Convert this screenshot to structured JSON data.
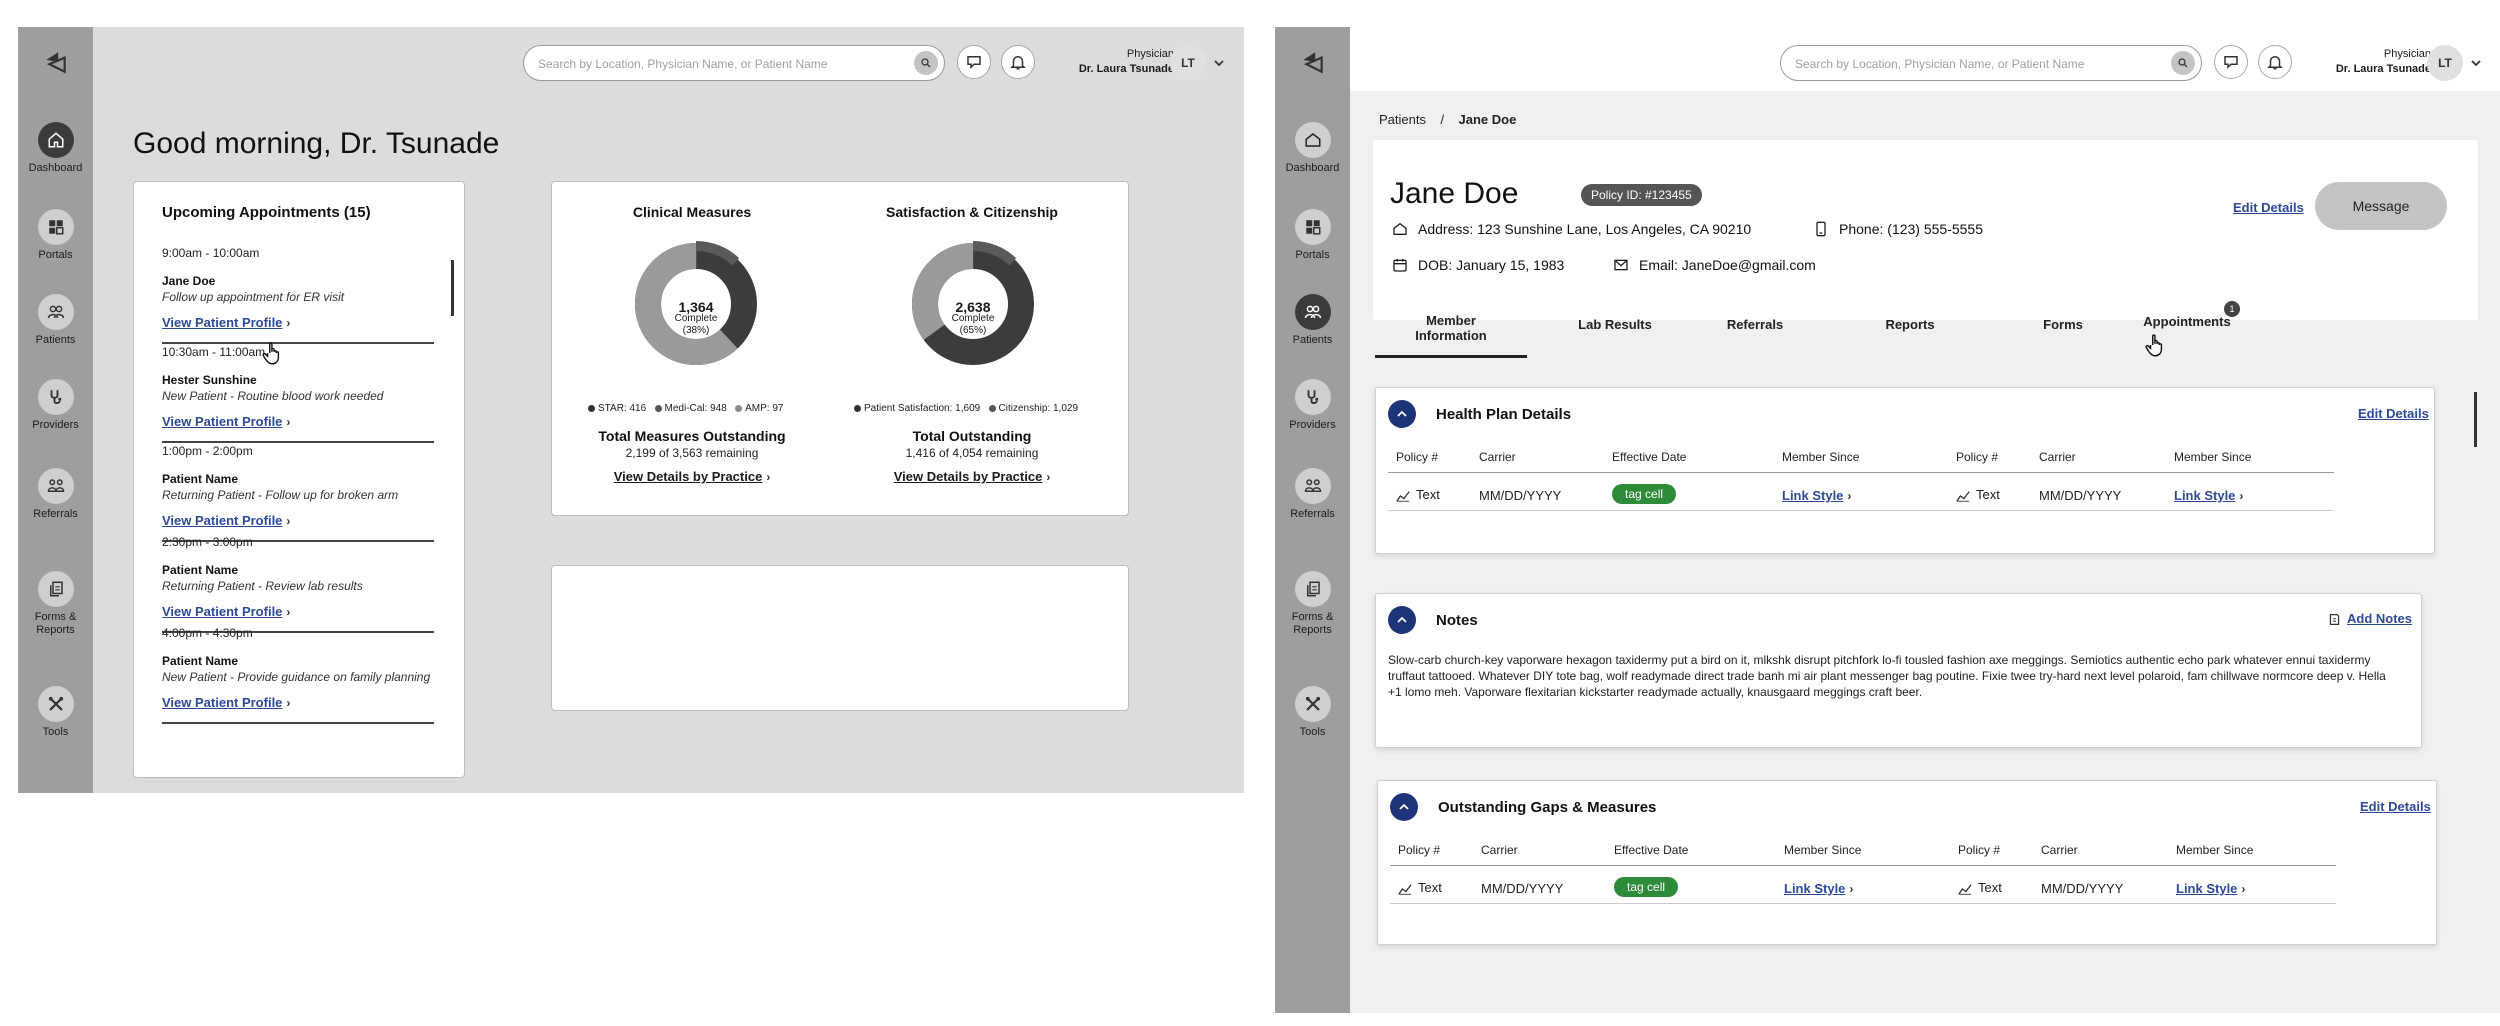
{
  "common": {
    "search_placeholder": "Search by Location, Physician Name, or Patient Name",
    "user_role": "Physician",
    "user_name": "Dr. Laura Tsunade",
    "avatar_initials": "LT"
  },
  "nav": [
    {
      "label": "Dashboard",
      "icon": "home-icon"
    },
    {
      "label": "Portals",
      "icon": "grid-icon"
    },
    {
      "label": "Patients",
      "icon": "users-icon"
    },
    {
      "label": "Providers",
      "icon": "stethoscope-icon"
    },
    {
      "label": "Referrals",
      "icon": "referrals-icon"
    },
    {
      "label": "Forms &",
      "label2": "Reports",
      "icon": "documents-icon"
    },
    {
      "label": "Tools",
      "icon": "tools-icon"
    }
  ],
  "dashboard": {
    "greeting": "Good morning, Dr. Tsunade",
    "appointments_title": "Upcoming Appointments (15)",
    "appointments": [
      {
        "time": "9:00am - 10:00am",
        "name": "Jane Doe",
        "desc": "Follow up appointment for ER visit",
        "link": "View Patient Profile"
      },
      {
        "time": "10:30am - 11:00am",
        "name": "Hester Sunshine",
        "desc": "New Patient - Routine blood work needed",
        "link": "View Patient Profile"
      },
      {
        "time": "1:00pm - 2:00pm",
        "name": "Patient Name",
        "desc": "Returning Patient - Follow up for broken arm",
        "link": "View Patient Profile"
      },
      {
        "time": "2:30pm - 3:00pm",
        "name": "Patient Name",
        "desc": "Returning Patient - Review lab results",
        "link": "View Patient Profile"
      },
      {
        "time": "4:00pm - 4:30pm",
        "name": "Patient Name",
        "desc": "New Patient - Provide guidance on family planning",
        "link": "View Patient Profile"
      }
    ],
    "clinical": {
      "title": "Clinical Measures",
      "center_value": "1,364",
      "center_label": "Complete",
      "center_pct": "(38%)",
      "percent": 38,
      "legend": [
        "STAR: 416",
        "Medi-Cal: 948",
        "AMP: 97"
      ],
      "total_title": "Total Measures Outstanding",
      "total_sub": "2,199 of 3,563 remaining",
      "link": "View Details by Practice"
    },
    "satisfaction": {
      "title": "Satisfaction & Citizenship",
      "center_value": "2,638",
      "center_label": "Complete",
      "center_pct": "(65%)",
      "percent": 65,
      "legend": [
        "Patient Satisfaction: 1,609",
        "Citizenship: 1,029"
      ],
      "total_title": "Total Outstanding",
      "total_sub": "1,416 of 4,054 remaining",
      "link": "View Details by Practice"
    }
  },
  "patient": {
    "breadcrumb_root": "Patients",
    "breadcrumb_sep": "/",
    "breadcrumb_current": "Jane Doe",
    "name": "Jane Doe",
    "policy_id": "Policy ID: #123455",
    "address": "Address: 123 Sunshine Lane, Los Angeles, CA 90210",
    "phone": "Phone: (123) 555-5555",
    "dob": "DOB: January 15, 1983",
    "email": "Email: JaneDoe@gmail.com",
    "edit_details": "Edit Details",
    "message": "Message",
    "tabs": [
      {
        "label": "Member",
        "label2": "Information"
      },
      {
        "label": "Lab Results"
      },
      {
        "label": "Referrals"
      },
      {
        "label": "Reports"
      },
      {
        "label": "Forms"
      },
      {
        "label": "Appointments",
        "badge": "1"
      }
    ],
    "health_plan": {
      "title": "Health Plan Details",
      "edit": "Edit Details",
      "headers": [
        "Policy #",
        "Carrier",
        "Effective Date",
        "Member Since",
        "Policy #",
        "Carrier",
        "Member Since"
      ],
      "row": {
        "policy": "Text",
        "carrier": "MM/DD/YYYY",
        "tag": "tag cell",
        "link": "Link Style",
        "policy2": "Text",
        "carrier2": "MM/DD/YYYY",
        "link2": "Link Style"
      }
    },
    "notes": {
      "title": "Notes",
      "add": "Add Notes",
      "body": "Slow-carb church-key vaporware hexagon taxidermy put a bird on it, mlkshk disrupt pitchfork lo-fi tousled fashion axe meggings. Semiotics authentic echo park whatever ennui taxidermy truffaut tattooed. Whatever DIY tote bag, wolf readymade direct trade banh mi air plant messenger bag poutine. Fixie twee try-hard next level polaroid, fam chillwave normcore deep v. Hella +1 lomo meh. Vaporware flexitarian kickstarter readymade actually, knausgaard meggings craft beer."
    },
    "gaps": {
      "title": "Outstanding Gaps & Measures",
      "edit": "Edit Details",
      "headers": [
        "Policy #",
        "Carrier",
        "Effective Date",
        "Member Since",
        "Policy #",
        "Carrier",
        "Member Since"
      ],
      "row": {
        "policy": "Text",
        "carrier": "MM/DD/YYYY",
        "tag": "tag cell",
        "link": "Link Style",
        "policy2": "Text",
        "carrier2": "MM/DD/YYYY",
        "link2": "Link Style"
      }
    }
  }
}
